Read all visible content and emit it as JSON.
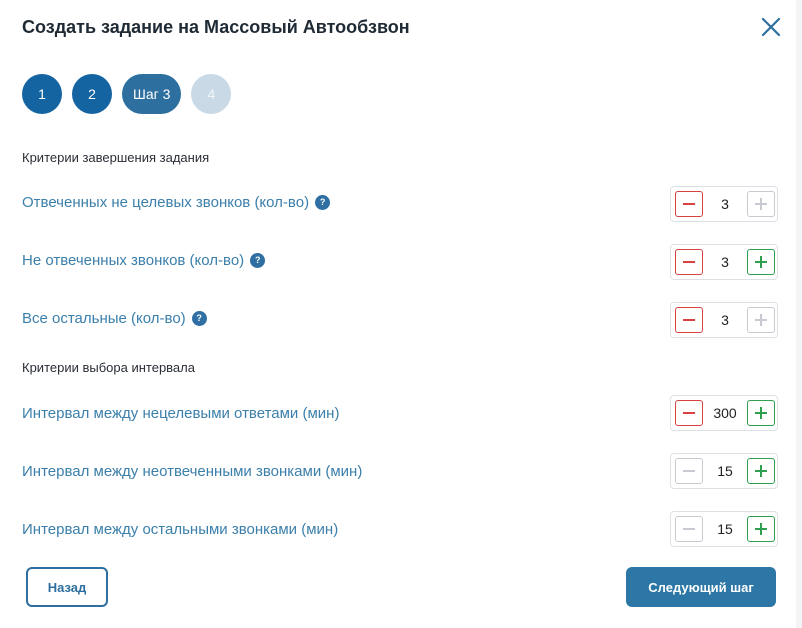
{
  "dialog": {
    "title": "Создать задание на Массовый Автообзвон"
  },
  "steps": [
    {
      "label": "1",
      "state": "done"
    },
    {
      "label": "2",
      "state": "done"
    },
    {
      "label": "Шаг 3",
      "state": "active"
    },
    {
      "label": "4",
      "state": "todo"
    }
  ],
  "sections": {
    "completion": "Критерии завершения задания",
    "interval": "Критерии выбора интервала"
  },
  "rows": [
    {
      "label": "Отвеченных не целевых звонков (кол-во)",
      "value": "3",
      "help": "?",
      "minus": "red",
      "plus": "grey"
    },
    {
      "label": "Не отвеченных звонков (кол-во)",
      "value": "3",
      "help": "?",
      "minus": "red",
      "plus": "green"
    },
    {
      "label": "Все остальные (кол-во)",
      "value": "3",
      "help": "?",
      "minus": "red",
      "plus": "grey"
    },
    {
      "label": "Интервал между нецелевыми ответами (мин)",
      "value": "300",
      "minus": "red",
      "plus": "green"
    },
    {
      "label": "Интервал между неотвеченными звонками (мин)",
      "value": "15",
      "minus": "grey",
      "plus": "green"
    },
    {
      "label": "Интервал между остальными звонками (мин)",
      "value": "15",
      "minus": "grey",
      "plus": "green"
    }
  ],
  "footer": {
    "back_label": "Назад",
    "next_label": "Следующий шаг"
  },
  "colors": {
    "accent": "#2d6f9f",
    "label": "#3b7fab",
    "minus_active": "#d94040",
    "plus_active": "#2f9e4f",
    "disabled": "#c7cbd1"
  },
  "icons": {
    "close": "close-icon",
    "help": "help-icon",
    "minus": "minus-icon",
    "plus": "plus-icon"
  }
}
